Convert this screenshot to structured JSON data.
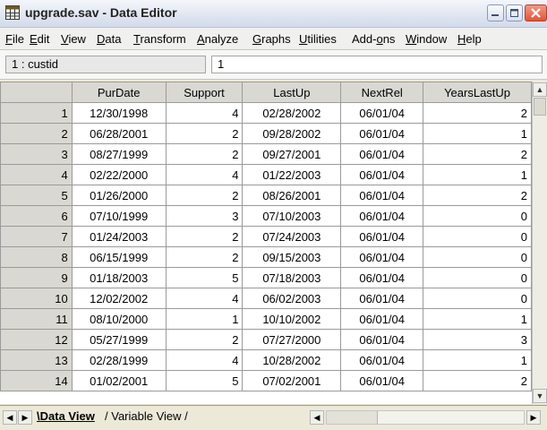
{
  "window": {
    "title": "upgrade.sav - Data Editor",
    "controls": [
      "minimize-icon",
      "maximize-icon",
      "close-icon"
    ]
  },
  "menu": [
    {
      "label": "File",
      "mnemonic": "F"
    },
    {
      "label": "Edit",
      "mnemonic": "E"
    },
    {
      "label": "View",
      "mnemonic": "V"
    },
    {
      "label": "Data",
      "mnemonic": "D"
    },
    {
      "label": "Transform",
      "mnemonic": "T"
    },
    {
      "label": "Analyze",
      "mnemonic": "A"
    },
    {
      "label": "Graphs",
      "mnemonic": "G"
    },
    {
      "label": "Utilities",
      "mnemonic": "U"
    },
    {
      "label": "Add-ons",
      "mnemonic": "o"
    },
    {
      "label": "Window",
      "mnemonic": "W"
    },
    {
      "label": "Help",
      "mnemonic": "H"
    }
  ],
  "cell_editor": {
    "ref": "1 : custid",
    "value": "1"
  },
  "grid": {
    "columns": [
      "PurDate",
      "Support",
      "LastUp",
      "NextRel",
      "YearsLastUp"
    ],
    "rows": [
      [
        "1",
        "12/30/1998",
        "4",
        "02/28/2002",
        "06/01/04",
        "2"
      ],
      [
        "2",
        "06/28/2001",
        "2",
        "09/28/2002",
        "06/01/04",
        "1"
      ],
      [
        "3",
        "08/27/1999",
        "2",
        "09/27/2001",
        "06/01/04",
        "2"
      ],
      [
        "4",
        "02/22/2000",
        "4",
        "01/22/2003",
        "06/01/04",
        "1"
      ],
      [
        "5",
        "01/26/2000",
        "2",
        "08/26/2001",
        "06/01/04",
        "2"
      ],
      [
        "6",
        "07/10/1999",
        "3",
        "07/10/2003",
        "06/01/04",
        "0"
      ],
      [
        "7",
        "01/24/2003",
        "2",
        "07/24/2003",
        "06/01/04",
        "0"
      ],
      [
        "8",
        "06/15/1999",
        "2",
        "09/15/2003",
        "06/01/04",
        "0"
      ],
      [
        "9",
        "01/18/2003",
        "5",
        "07/18/2003",
        "06/01/04",
        "0"
      ],
      [
        "10",
        "12/02/2002",
        "4",
        "06/02/2003",
        "06/01/04",
        "0"
      ],
      [
        "11",
        "08/10/2000",
        "1",
        "10/10/2002",
        "06/01/04",
        "1"
      ],
      [
        "12",
        "05/27/1999",
        "2",
        "07/27/2000",
        "06/01/04",
        "3"
      ],
      [
        "13",
        "02/28/1999",
        "4",
        "10/28/2002",
        "06/01/04",
        "1"
      ],
      [
        "14",
        "01/02/2001",
        "5",
        "07/02/2001",
        "06/01/04",
        "2"
      ]
    ]
  },
  "tabs": {
    "data_view": "Data View",
    "variable_view": "Variable View"
  },
  "colors": {
    "header_bg": "#d9d8d2",
    "close_button": "#e0553b"
  }
}
